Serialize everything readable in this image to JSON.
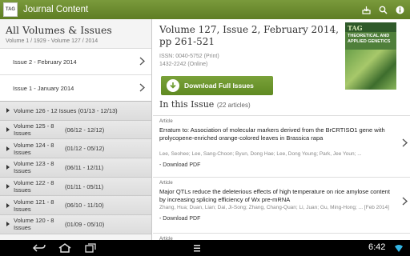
{
  "app": {
    "icon_text": "TAG",
    "title": "Journal Content",
    "actions": [
      "download-icon",
      "search-icon",
      "info-icon"
    ]
  },
  "left": {
    "heading": "All Volumes & Issues",
    "subheading": "Volume 1 / 1929 - Volume 127 / 2014",
    "issues": [
      {
        "label": "Issue 2 - February 2014"
      },
      {
        "label": "Issue 1 - January 2014"
      }
    ],
    "volumes": [
      {
        "name": "Volume 126 - 12 Issues (01/13 - 12/13)",
        "range": ""
      },
      {
        "name": "Volume 125 - 8 Issues",
        "range": "(06/12 - 12/12)"
      },
      {
        "name": "Volume 124 - 8 Issues",
        "range": "(01/12 - 05/12)"
      },
      {
        "name": "Volume 123 - 8 Issues",
        "range": "(06/11 - 12/11)"
      },
      {
        "name": "Volume 122 - 8 Issues",
        "range": "(01/11 - 05/11)"
      },
      {
        "name": "Volume 121 - 8 Issues",
        "range": "(06/10 - 11/10)"
      },
      {
        "name": "Volume 120 - 8 Issues",
        "range": "(01/09 - 05/10)"
      }
    ]
  },
  "main": {
    "volume_heading": "Volume 127, Issue 2, February 2014, pp 261-521",
    "issn_print": "ISSN: 0040-5752 (Print)",
    "issn_online": "1432-2242 (Online)",
    "cover": {
      "tag": "TAG",
      "journal": "THEORETICAL AND APPLIED GENETICS"
    },
    "download_label": "Download Full Issues",
    "in_issue_label": "In this Issue",
    "article_count": "(22 articles)",
    "articles": [
      {
        "type": "Article",
        "title": "Erratum to: Association of molecular markers derived from the BrCRTISO1 gene with prolycopene-enriched orange-colored leaves in Brassica rapa",
        "authors": "Lee, Seohee; Lee, Sang-Choon; Byun, Dong Hae; Lee, Dong Young; Park, Jee Youn; ...",
        "download": "- Download PDF"
      },
      {
        "type": "Article",
        "title": "Major QTLs reduce the deleterious effects of high temperature on rice amylose content by increasing splicing efficiency of Wx pre-mRNA",
        "authors": "Zhang, Hua; Duan, Lian; Dai, Ji-Song; Zhang, Chang-Quan; Li, Juan; Gu, Ming-Hong; ... [Feb 2014]",
        "download": "- Download PDF"
      },
      {
        "type": "Article",
        "title": "",
        "authors": "",
        "download": ""
      }
    ]
  },
  "status": {
    "clock": "6:42"
  },
  "colors": {
    "topbar": "#6b8c2f",
    "button": "#6e9830"
  }
}
